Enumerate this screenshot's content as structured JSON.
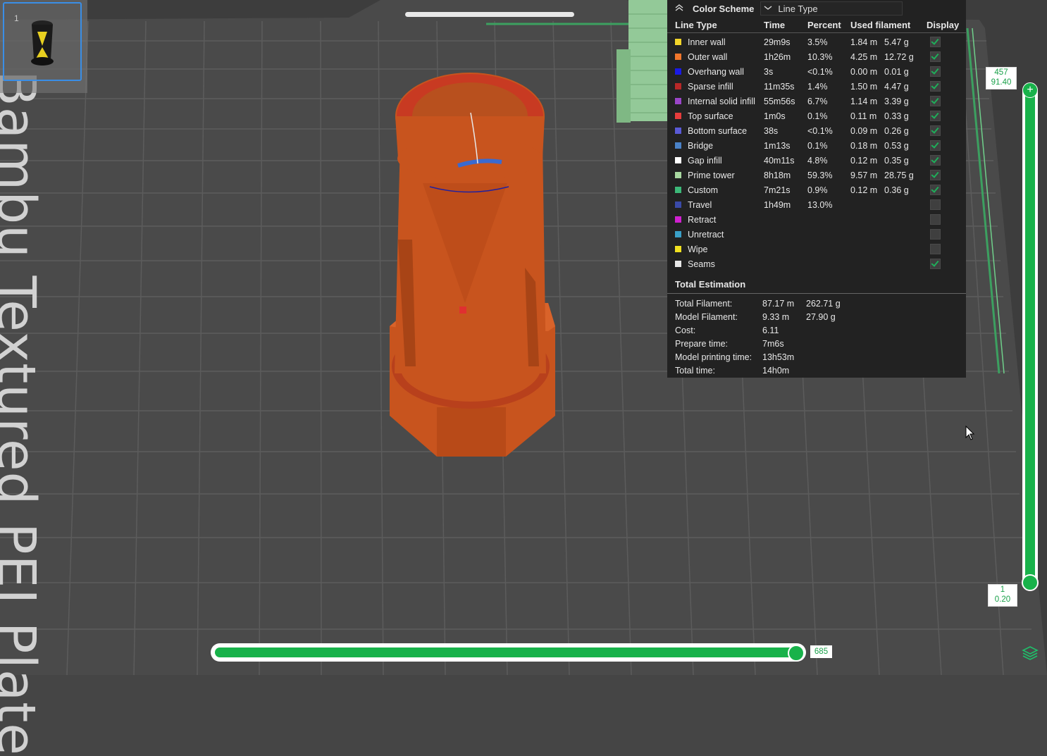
{
  "plate": {
    "label": "Bambu Textured PEI Plate",
    "thumbnail_index": "1"
  },
  "legend": {
    "header": {
      "title": "Color Scheme",
      "scheme_value": "Line Type"
    },
    "columns": {
      "line_type": "Line Type",
      "time": "Time",
      "percent": "Percent",
      "used_filament": "Used filament",
      "display": "Display"
    },
    "rows": [
      {
        "name": "Inner wall",
        "color": "#f2d52a",
        "time": "29m9s",
        "percent": "3.5%",
        "length": "1.84 m",
        "weight": "5.47 g",
        "checked": true
      },
      {
        "name": "Outer wall",
        "color": "#f2772c",
        "time": "1h26m",
        "percent": "10.3%",
        "length": "4.25 m",
        "weight": "12.72 g",
        "checked": true
      },
      {
        "name": "Overhang wall",
        "color": "#1a1ae6",
        "time": "3s",
        "percent": "<0.1%",
        "length": "0.00 m",
        "weight": "0.01 g",
        "checked": true
      },
      {
        "name": "Sparse infill",
        "color": "#b82828",
        "time": "11m35s",
        "percent": "1.4%",
        "length": "1.50 m",
        "weight": "4.47 g",
        "checked": true
      },
      {
        "name": "Internal solid infill",
        "color": "#9a45c8",
        "time": "55m56s",
        "percent": "6.7%",
        "length": "1.14 m",
        "weight": "3.39 g",
        "checked": true
      },
      {
        "name": "Top surface",
        "color": "#e63c3c",
        "time": "1m0s",
        "percent": "0.1%",
        "length": "0.11 m",
        "weight": "0.33 g",
        "checked": true
      },
      {
        "name": "Bottom surface",
        "color": "#5a5ad6",
        "time": "38s",
        "percent": "<0.1%",
        "length": "0.09 m",
        "weight": "0.26 g",
        "checked": true
      },
      {
        "name": "Bridge",
        "color": "#4a82c8",
        "time": "1m13s",
        "percent": "0.1%",
        "length": "0.18 m",
        "weight": "0.53 g",
        "checked": true
      },
      {
        "name": "Gap infill",
        "color": "#ffffff",
        "time": "40m11s",
        "percent": "4.8%",
        "length": "0.12 m",
        "weight": "0.35 g",
        "checked": true
      },
      {
        "name": "Prime tower",
        "color": "#a8d8a0",
        "time": "8h18m",
        "percent": "59.3%",
        "length": "9.57 m",
        "weight": "28.75 g",
        "checked": true
      },
      {
        "name": "Custom",
        "color": "#3cb878",
        "time": "7m21s",
        "percent": "0.9%",
        "length": "0.12 m",
        "weight": "0.36 g",
        "checked": true
      },
      {
        "name": "Travel",
        "color": "#3a4aa8",
        "time": "1h49m",
        "percent": "13.0%",
        "length": "",
        "weight": "",
        "checked": false
      },
      {
        "name": "Retract",
        "color": "#d020d0",
        "time": "",
        "percent": "",
        "length": "",
        "weight": "",
        "checked": false
      },
      {
        "name": "Unretract",
        "color": "#3aa0c8",
        "time": "",
        "percent": "",
        "length": "",
        "weight": "",
        "checked": false
      },
      {
        "name": "Wipe",
        "color": "#f0e020",
        "time": "",
        "percent": "",
        "length": "",
        "weight": "",
        "checked": false
      },
      {
        "name": "Seams",
        "color": "#e8e8e8",
        "time": "",
        "percent": "",
        "length": "",
        "weight": "",
        "checked": true
      }
    ],
    "total": {
      "title": "Total Estimation",
      "rows": [
        {
          "label": "Total Filament:",
          "v1": "87.17 m",
          "v2": "262.71 g"
        },
        {
          "label": "Model Filament:",
          "v1": "9.33 m",
          "v2": "27.90 g"
        },
        {
          "label": "Cost:",
          "v1": "6.11",
          "v2": ""
        },
        {
          "label": "Prepare time:",
          "v1": "7m6s",
          "v2": ""
        },
        {
          "label": "Model printing time:",
          "v1": "13h53m",
          "v2": ""
        },
        {
          "label": "Total time:",
          "v1": "14h0m",
          "v2": ""
        }
      ]
    }
  },
  "layer_slider": {
    "top_layer": "457",
    "top_height": "91.40",
    "bottom_layer": "1",
    "bottom_height": "0.20",
    "handle_icon": "plus-icon"
  },
  "move_slider": {
    "value": "685"
  },
  "colors": {
    "accent": "#18b24a",
    "model": "#c8541e",
    "background": "#454545",
    "panel": "#222222"
  }
}
